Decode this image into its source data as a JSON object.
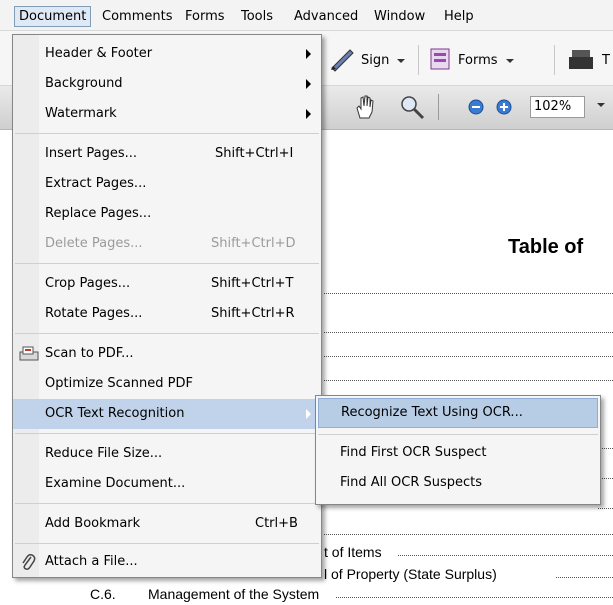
{
  "menubar": {
    "items": [
      "Document",
      "Comments",
      "Forms",
      "Tools",
      "Advanced",
      "Window",
      "Help"
    ]
  },
  "toolbar": {
    "sign_label": "Sign",
    "forms_label": "Forms",
    "truncated_label": "T",
    "zoom_value": "102%"
  },
  "document_menu": {
    "header_footer": "Header & Footer",
    "background": "Background",
    "watermark": "Watermark",
    "insert_pages": "Insert Pages...",
    "insert_pages_sc": "Shift+Ctrl+I",
    "extract_pages": "Extract Pages...",
    "replace_pages": "Replace Pages...",
    "delete_pages": "Delete Pages...",
    "delete_pages_sc": "Shift+Ctrl+D",
    "crop_pages": "Crop Pages...",
    "crop_pages_sc": "Shift+Ctrl+T",
    "rotate_pages": "Rotate Pages...",
    "rotate_pages_sc": "Shift+Ctrl+R",
    "scan_to_pdf": "Scan to PDF...",
    "optimize_scanned": "Optimize Scanned PDF",
    "ocr": "OCR Text Recognition",
    "reduce_size": "Reduce File Size...",
    "examine": "Examine Document...",
    "add_bookmark": "Add Bookmark",
    "add_bookmark_sc": "Ctrl+B",
    "attach_file": "Attach a File..."
  },
  "ocr_submenu": {
    "recognize": "Recognize Text Using OCR...",
    "find_first": "Find First OCR Suspect",
    "find_all": "Find All OCR Suspects"
  },
  "document": {
    "title": "Table of",
    "line1": "t of Items",
    "line2": "l of Property (State Surplus)",
    "line3_num": "C.6.",
    "line3_text": "Management of the System"
  }
}
